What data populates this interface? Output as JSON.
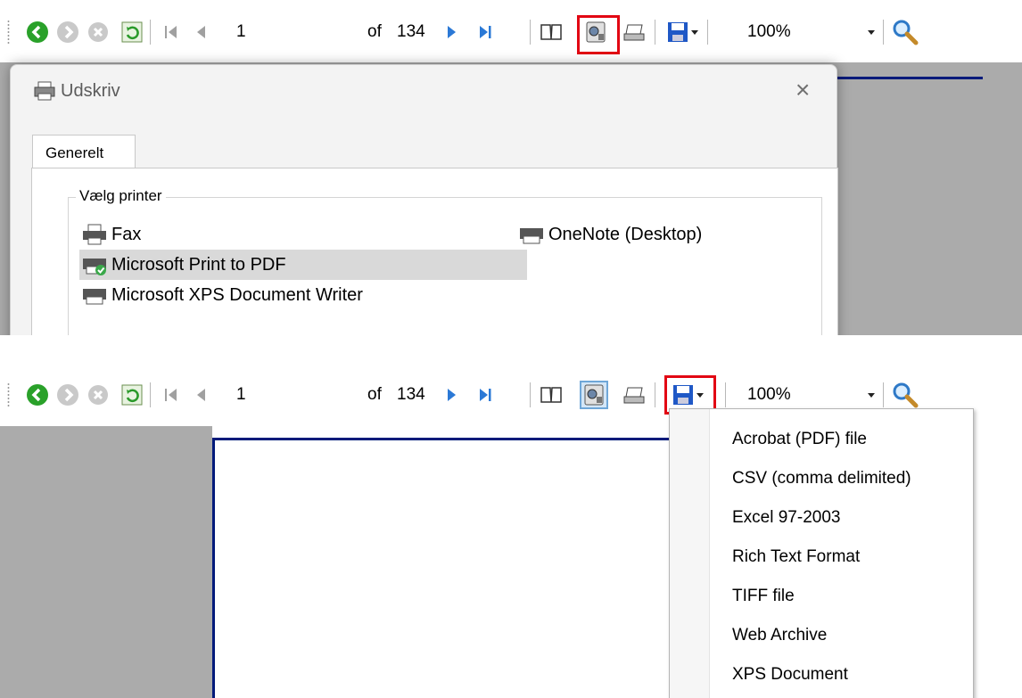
{
  "toolbar": {
    "page_number": "1",
    "of_label": "of",
    "total_pages": "134",
    "zoom": "100%"
  },
  "dialog": {
    "title": "Udskriv",
    "close": "×",
    "tab": "Generelt",
    "group_label": "Vælg printer",
    "printers": [
      "Fax",
      "Microsoft Print to PDF",
      "Microsoft XPS Document Writer",
      "OneNote (Desktop)"
    ],
    "selected_printer": "Microsoft Print to PDF"
  },
  "export_menu": {
    "items": [
      "Acrobat (PDF) file",
      "CSV (comma delimited)",
      "Excel 97-2003",
      "Rich Text Format",
      "TIFF file",
      "Web Archive",
      "XPS Document"
    ]
  },
  "colors": {
    "highlight": "#e20613",
    "accent": "#001a7a"
  }
}
